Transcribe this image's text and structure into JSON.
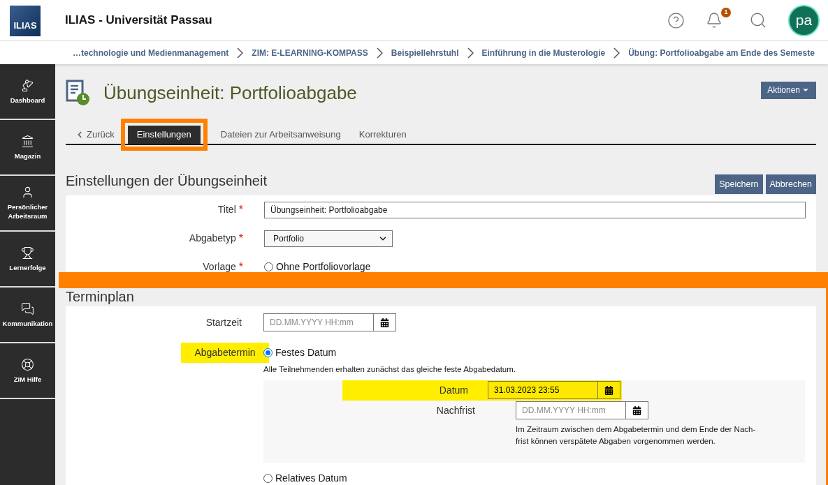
{
  "header": {
    "logo": "ILIAS",
    "title": "ILIAS - Universität Passau",
    "notification_count": "1",
    "avatar": "pa"
  },
  "breadcrumbs": [
    "…technologie und Medienmanagement",
    "ZIM: E-LEARNING-KOMPASS",
    "Beispiellehrstuhl",
    "Einführung in die Musterologie",
    "Übung: Portfolioabgabe am Ende des Semeste"
  ],
  "sidebar": {
    "items": [
      {
        "label": "Dashboard"
      },
      {
        "label": "Magazin"
      },
      {
        "label": "Persönlicher Arbeitsraum"
      },
      {
        "label": "Lernerfolge"
      },
      {
        "label": "Kommunikation"
      },
      {
        "label": "ZIM Hilfe"
      }
    ]
  },
  "page": {
    "title": "Übungseinheit: Portfolioabgabe",
    "actions_button": "Aktionen",
    "tabs": [
      {
        "kind": "back",
        "label": "Zurück",
        "selected": false,
        "highlighted": false
      },
      {
        "kind": "tab",
        "label": "Einstellungen",
        "selected": true,
        "highlighted": true
      },
      {
        "kind": "tab",
        "label": "Dateien zur Arbeitsanweisung",
        "selected": false,
        "highlighted": false
      },
      {
        "kind": "tab",
        "label": "Korrekturen",
        "selected": false,
        "highlighted": false
      }
    ]
  },
  "settings": {
    "title": "Einstellungen der Übungseinheit",
    "buttons": [
      "Speichern",
      "Abbrechen"
    ],
    "fields": [
      {
        "kind": "text",
        "label": "Titel",
        "required_mark": "*",
        "value": "Übungseinheit: Portfolioabgabe"
      },
      {
        "kind": "select",
        "label": "Abgabetyp",
        "required_mark": "*",
        "value": "Portfolio"
      },
      {
        "kind": "radio",
        "label": "Vorlage",
        "required_mark": "*",
        "option": "Ohne Portfoliovorlage",
        "selected": false
      }
    ]
  },
  "schedule": {
    "title": "Terminplan",
    "startzeit": {
      "label": "Startzeit",
      "placeholder": "DD.MM.YYYY HH:mm"
    },
    "deadline": {
      "label": "Abgabetermin",
      "highlighted": true,
      "options": [
        {
          "label": "Festes Datum",
          "selected": true,
          "info": "Alle Teilnehmenden erhalten zunächst das gleiche feste Abgabedatum.",
          "subfields": [
            {
              "label": "Datum",
              "value": "31.03.2023 23:55",
              "highlighted": true
            },
            {
              "label": "Nachfrist",
              "placeholder": "DD.MM.YYYY HH:mm",
              "highlighted": false,
              "info": "Im Zeitraum zwischen dem Abgabetermin und dem Ende der Nach-frist können verspätete Abgaben vorgenommen werden."
            }
          ]
        },
        {
          "label": "Relatives Datum",
          "selected": false
        }
      ]
    }
  }
}
